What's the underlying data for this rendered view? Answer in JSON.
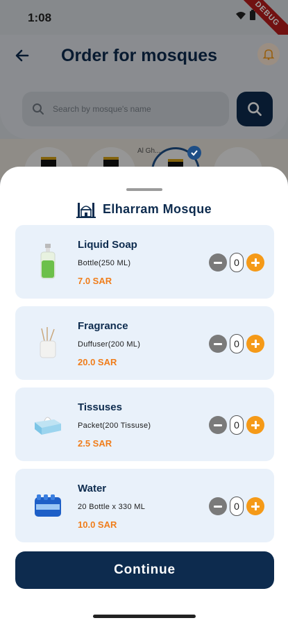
{
  "status_bar": {
    "time": "1:08",
    "debug_label": "DEBUG"
  },
  "header": {
    "title": "Order for mosques",
    "search": {
      "placeholder": "Search by mosque's name"
    }
  },
  "map": {
    "label": "Al Gh..."
  },
  "sheet": {
    "title": "Elharram Mosque",
    "products": [
      {
        "name": "Liquid Soap",
        "description": "Bottle(250 ML)",
        "price": "7.0 SAR",
        "quantity": "0",
        "icon": "soap-bottle-icon"
      },
      {
        "name": "Fragrance",
        "description": "Duffuser(200 ML)",
        "price": "20.0 SAR",
        "quantity": "0",
        "icon": "diffuser-icon"
      },
      {
        "name": "Tissuses",
        "description": "Packet(200 Tissuse)",
        "price": "2.5 SAR",
        "quantity": "0",
        "icon": "tissue-box-icon"
      },
      {
        "name": "Water",
        "description": "20 Bottle x 330 ML",
        "price": "10.0 SAR",
        "quantity": "0",
        "icon": "water-pack-icon"
      }
    ],
    "continue_label": "Continue"
  },
  "colors": {
    "navy": "#0d2b4e",
    "accent": "#f59a18",
    "price": "#f07d1a",
    "card": "#e9f1fa"
  }
}
